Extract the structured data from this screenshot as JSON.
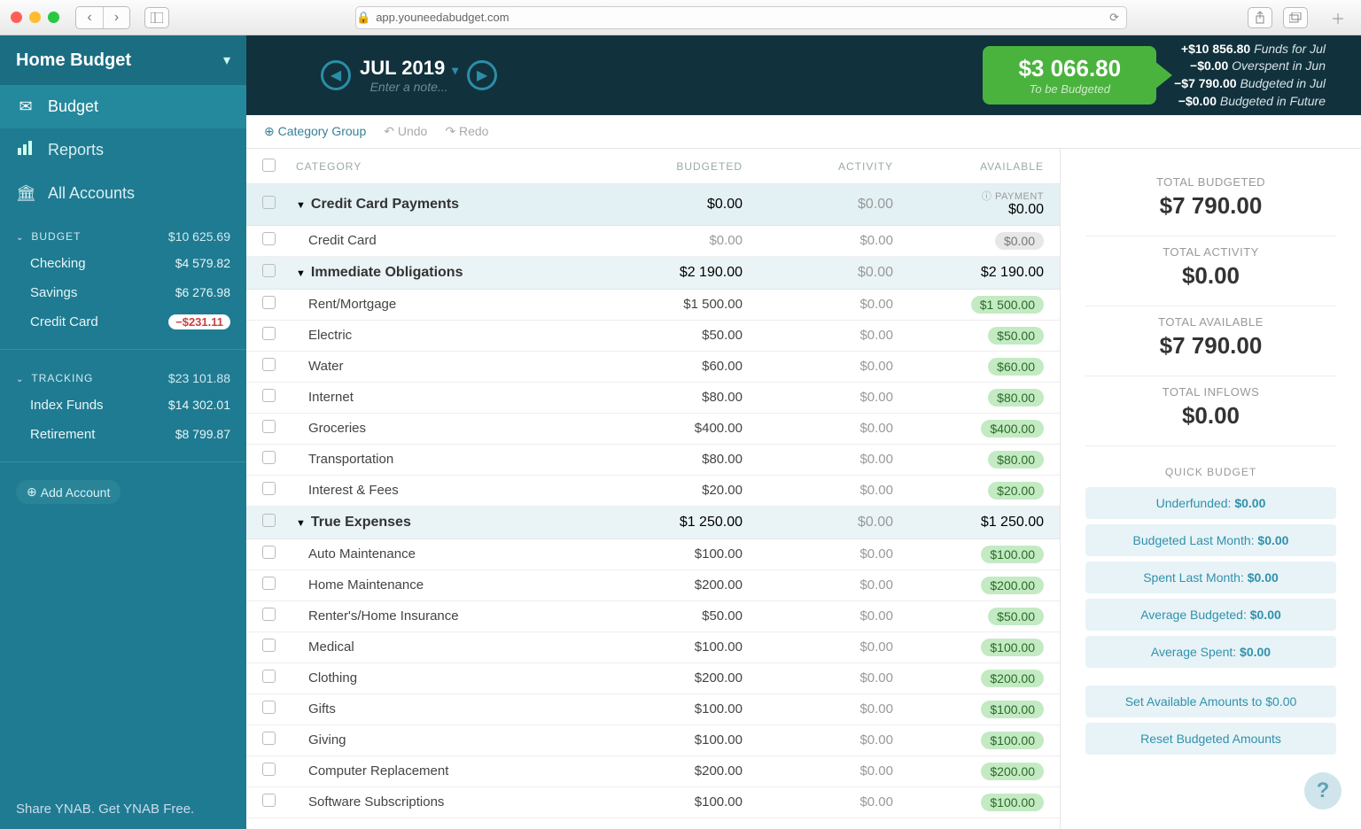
{
  "browser": {
    "url": "app.youneedabudget.com"
  },
  "sidebar": {
    "budget_name": "Home Budget",
    "nav": {
      "budget": "Budget",
      "reports": "Reports",
      "accounts": "All Accounts"
    },
    "sections": [
      {
        "title": "BUDGET",
        "total": "$10 625.69",
        "accounts": [
          {
            "name": "Checking",
            "amt": "$4 579.82"
          },
          {
            "name": "Savings",
            "amt": "$6 276.98"
          },
          {
            "name": "Credit Card",
            "amt": "−$231.11",
            "negative": true
          }
        ]
      },
      {
        "title": "TRACKING",
        "total": "$23 101.88",
        "accounts": [
          {
            "name": "Index Funds",
            "amt": "$14 302.01"
          },
          {
            "name": "Retirement",
            "amt": "$8 799.87"
          }
        ]
      }
    ],
    "add_account": "Add Account",
    "footer": "Share YNAB. Get YNAB Free."
  },
  "header": {
    "month": "JUL 2019",
    "note_placeholder": "Enter a note...",
    "tbb": {
      "amount": "$3 066.80",
      "label": "To be Budgeted"
    },
    "summary": [
      {
        "v": "+$10 856.80",
        "l": "Funds for Jul"
      },
      {
        "v": "−$0.00",
        "l": "Overspent in Jun"
      },
      {
        "v": "−$7 790.00",
        "l": "Budgeted in Jul"
      },
      {
        "v": "−$0.00",
        "l": "Budgeted in Future"
      }
    ]
  },
  "toolbar": {
    "category_group": "Category Group",
    "undo": "Undo",
    "redo": "Redo"
  },
  "table": {
    "headers": {
      "category": "CATEGORY",
      "budgeted": "BUDGETED",
      "activity": "ACTIVITY",
      "available": "AVAILABLE"
    },
    "payment_label": "PAYMENT",
    "groups": [
      {
        "name": "Credit Card Payments",
        "budgeted": "$0.00",
        "activity": "$0.00",
        "available": "$0.00",
        "is_cc": true,
        "rows": [
          {
            "name": "Credit Card",
            "budgeted": "$0.00",
            "activity": "$0.00",
            "available": "$0.00",
            "zero": true
          }
        ]
      },
      {
        "name": "Immediate Obligations",
        "budgeted": "$2 190.00",
        "activity": "$0.00",
        "available": "$2 190.00",
        "rows": [
          {
            "name": "Rent/Mortgage",
            "budgeted": "$1 500.00",
            "activity": "$0.00",
            "available": "$1 500.00"
          },
          {
            "name": "Electric",
            "budgeted": "$50.00",
            "activity": "$0.00",
            "available": "$50.00"
          },
          {
            "name": "Water",
            "budgeted": "$60.00",
            "activity": "$0.00",
            "available": "$60.00"
          },
          {
            "name": "Internet",
            "budgeted": "$80.00",
            "activity": "$0.00",
            "available": "$80.00"
          },
          {
            "name": "Groceries",
            "budgeted": "$400.00",
            "activity": "$0.00",
            "available": "$400.00"
          },
          {
            "name": "Transportation",
            "budgeted": "$80.00",
            "activity": "$0.00",
            "available": "$80.00"
          },
          {
            "name": "Interest & Fees",
            "budgeted": "$20.00",
            "activity": "$0.00",
            "available": "$20.00"
          }
        ]
      },
      {
        "name": "True Expenses",
        "budgeted": "$1 250.00",
        "activity": "$0.00",
        "available": "$1 250.00",
        "rows": [
          {
            "name": "Auto Maintenance",
            "budgeted": "$100.00",
            "activity": "$0.00",
            "available": "$100.00"
          },
          {
            "name": "Home Maintenance",
            "budgeted": "$200.00",
            "activity": "$0.00",
            "available": "$200.00"
          },
          {
            "name": "Renter's/Home Insurance",
            "budgeted": "$50.00",
            "activity": "$0.00",
            "available": "$50.00"
          },
          {
            "name": "Medical",
            "budgeted": "$100.00",
            "activity": "$0.00",
            "available": "$100.00"
          },
          {
            "name": "Clothing",
            "budgeted": "$200.00",
            "activity": "$0.00",
            "available": "$200.00"
          },
          {
            "name": "Gifts",
            "budgeted": "$100.00",
            "activity": "$0.00",
            "available": "$100.00"
          },
          {
            "name": "Giving",
            "budgeted": "$100.00",
            "activity": "$0.00",
            "available": "$100.00"
          },
          {
            "name": "Computer Replacement",
            "budgeted": "$200.00",
            "activity": "$0.00",
            "available": "$200.00"
          },
          {
            "name": "Software Subscriptions",
            "budgeted": "$100.00",
            "activity": "$0.00",
            "available": "$100.00"
          }
        ]
      }
    ]
  },
  "rpanel": {
    "stats": [
      {
        "label": "TOTAL BUDGETED",
        "value": "$7 790.00"
      },
      {
        "label": "TOTAL ACTIVITY",
        "value": "$0.00"
      },
      {
        "label": "TOTAL AVAILABLE",
        "value": "$7 790.00"
      },
      {
        "label": "TOTAL INFLOWS",
        "value": "$0.00"
      }
    ],
    "quick_budget_title": "QUICK BUDGET",
    "quick_budget": [
      {
        "label": "Underfunded: ",
        "value": "$0.00"
      },
      {
        "label": "Budgeted Last Month: ",
        "value": "$0.00"
      },
      {
        "label": "Spent Last Month: ",
        "value": "$0.00"
      },
      {
        "label": "Average Budgeted: ",
        "value": "$0.00"
      },
      {
        "label": "Average Spent: ",
        "value": "$0.00"
      }
    ],
    "actions": [
      "Set Available Amounts to $0.00",
      "Reset Budgeted Amounts"
    ]
  }
}
